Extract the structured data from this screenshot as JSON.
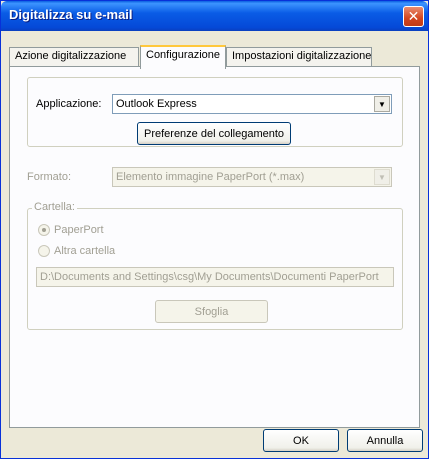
{
  "window": {
    "title": "Digitalizza su e-mail",
    "close_glyph": "✕"
  },
  "tabs": [
    {
      "label": "Azione digitalizzazione",
      "active": false
    },
    {
      "label": "Configurazione",
      "active": true
    },
    {
      "label": "Impostazioni digitalizzazione",
      "active": false
    }
  ],
  "config": {
    "applicazione_label": "Applicazione:",
    "applicazione_value": "Outlook Express",
    "preferenze_button": "Preferenze del collegamento",
    "formato_label": "Formato:",
    "formato_value": "Elemento immagine PaperPort (*.max)",
    "cartella_label": "Cartella:",
    "radio_paperport": "PaperPort",
    "radio_altra": "Altra cartella",
    "path_value": "D:\\Documents and Settings\\csg\\My Documents\\Documenti PaperPort",
    "sfoglia_button": "Sfoglia"
  },
  "footer": {
    "ok_label": "OK",
    "cancel_label": "Annulla"
  },
  "icons": {
    "dropdown": "▼"
  }
}
